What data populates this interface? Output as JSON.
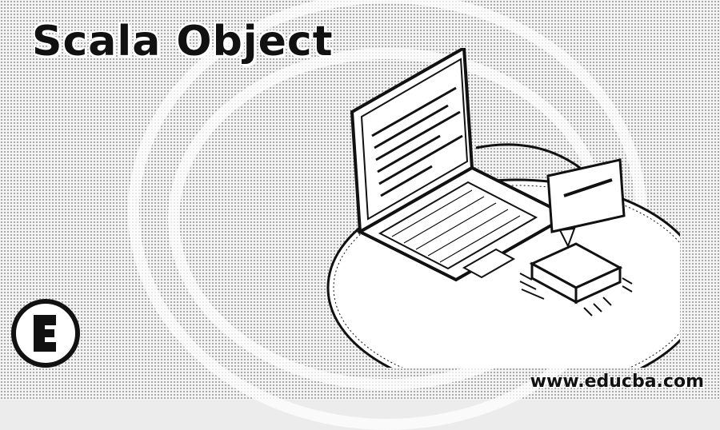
{
  "banner": {
    "title": "Scala Object",
    "site_url": "www.educba.com",
    "logo_icon": "educba-logo-icon",
    "illustration_icon": "laptop-chip-illustration-icon"
  },
  "colors": {
    "background": "#f4f4f4",
    "ink": "#111111",
    "highlight": "#ffffff"
  }
}
